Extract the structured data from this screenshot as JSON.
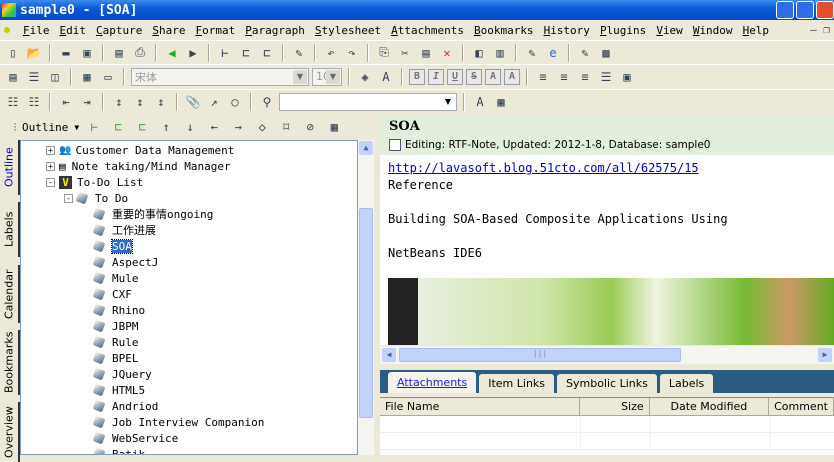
{
  "window": {
    "title": "sample0 - [SOA]"
  },
  "menu": [
    "File",
    "Edit",
    "Capture",
    "Share",
    "Format",
    "Paragraph",
    "Stylesheet",
    "Attachments",
    "Bookmarks",
    "History",
    "Plugins",
    "View",
    "Window",
    "Help"
  ],
  "toolbar": {
    "font_name": "宋体",
    "font_size": "10",
    "search_value": ""
  },
  "outline_bar": {
    "label": "Outline"
  },
  "side_tabs": [
    "Outline",
    "Labels",
    "Calendar",
    "Bookmarks",
    "Overview"
  ],
  "tree": [
    {
      "label": "Customer Data Management",
      "level": 0,
      "expander": "+",
      "icon": "people-icon"
    },
    {
      "label": "Note taking/Mind Manager",
      "level": 0,
      "expander": "+",
      "icon": "note-icon"
    },
    {
      "label": "To-Do List",
      "level": 0,
      "expander": "-",
      "icon": "todo-icon"
    },
    {
      "label": "To Do",
      "level": 1,
      "expander": "-",
      "icon": "gem-icon"
    },
    {
      "label": "重要的事情ongoing",
      "level": 2
    },
    {
      "label": "工作进展",
      "level": 2
    },
    {
      "label": "SOA",
      "level": 2,
      "selected": true
    },
    {
      "label": "AspectJ",
      "level": 2
    },
    {
      "label": "Mule",
      "level": 2
    },
    {
      "label": "CXF",
      "level": 2
    },
    {
      "label": "Rhino",
      "level": 2
    },
    {
      "label": "JBPM",
      "level": 2
    },
    {
      "label": "Rule",
      "level": 2
    },
    {
      "label": "BPEL",
      "level": 2
    },
    {
      "label": "JQuery",
      "level": 2
    },
    {
      "label": "HTML5",
      "level": 2
    },
    {
      "label": "Andriod",
      "level": 2
    },
    {
      "label": "Job Interview Companion",
      "level": 2
    },
    {
      "label": "WebService",
      "level": 2
    },
    {
      "label": "Batik",
      "level": 2
    }
  ],
  "note": {
    "title": "SOA",
    "status": "Editing: RTF-Note, Updated: 2012-1-8, Database: sample0",
    "link": "http://lavasoft.blog.51cto.com/all/62575/15",
    "lines": [
      "Reference",
      "Building SOA-Based Composite Applications Using",
      "NetBeans IDE6"
    ]
  },
  "bottom_tabs": [
    "Attachments",
    "Item Links",
    "Symbolic Links",
    "Labels"
  ],
  "attachments": {
    "columns": [
      "File Name",
      "Size",
      "Date Modified",
      "Comment"
    ],
    "rows": []
  },
  "colors": {
    "title_bar": "#0a5bd6",
    "header_bg": "#e1efdc",
    "tab_bar": "#2b5c82",
    "selection": "#316ac5"
  }
}
